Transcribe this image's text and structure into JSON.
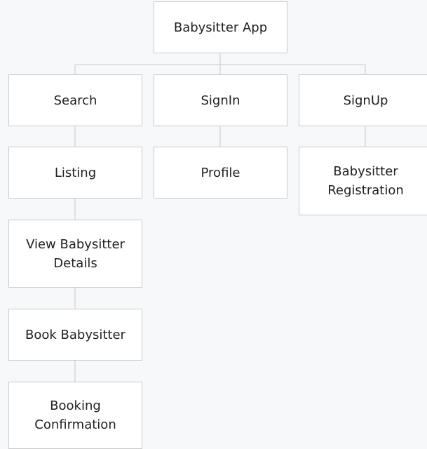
{
  "diagram": {
    "root": {
      "label": "Babysitter App"
    },
    "nodes": {
      "search": {
        "label": "Search"
      },
      "signin": {
        "label": "SignIn"
      },
      "signup": {
        "label": "SignUp"
      },
      "listing": {
        "label": "Listing"
      },
      "profile": {
        "label": "Profile"
      },
      "babysitter_registration": {
        "label": "Babysitter\nRegistration"
      },
      "view_babysitter_details": {
        "label": "View Babysitter\nDetails"
      },
      "book_babysitter": {
        "label": "Book Babysitter"
      },
      "booking_confirmation": {
        "label": "Booking\nConfirmation"
      }
    }
  }
}
